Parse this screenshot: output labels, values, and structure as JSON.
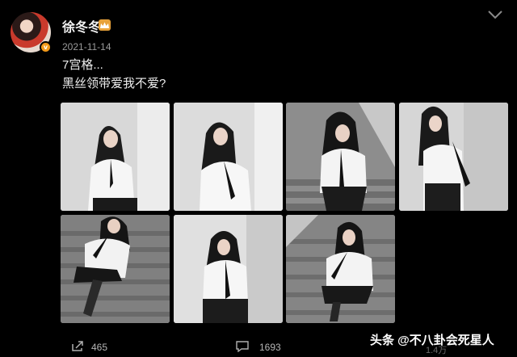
{
  "post": {
    "username": "徐冬冬",
    "verified_badge": "v",
    "timestamp": "2021-11-14",
    "line1": "7宫格...",
    "line2": "黑丝领带爱我不爱?"
  },
  "icons": {
    "vip": "crown-icon",
    "more": "chevron-down-icon",
    "repost": "share-icon",
    "comment": "comment-icon"
  },
  "footer": {
    "reposts": "465",
    "comments": "1693",
    "views": "1.4万"
  },
  "watermark": "头条 @不八卦会死星人",
  "colors": {
    "background": "#000000",
    "vip_gold": "#e8a23a",
    "verified_orange": "#f39a1a"
  },
  "photos": [
    {
      "id": "photo-1",
      "scene": "wall"
    },
    {
      "id": "photo-2",
      "scene": "wall"
    },
    {
      "id": "photo-3",
      "scene": "stairs"
    },
    {
      "id": "photo-4",
      "scene": "wall"
    },
    {
      "id": "photo-5",
      "scene": "stairs"
    },
    {
      "id": "photo-6",
      "scene": "wall"
    },
    {
      "id": "photo-7",
      "scene": "stairs"
    }
  ]
}
